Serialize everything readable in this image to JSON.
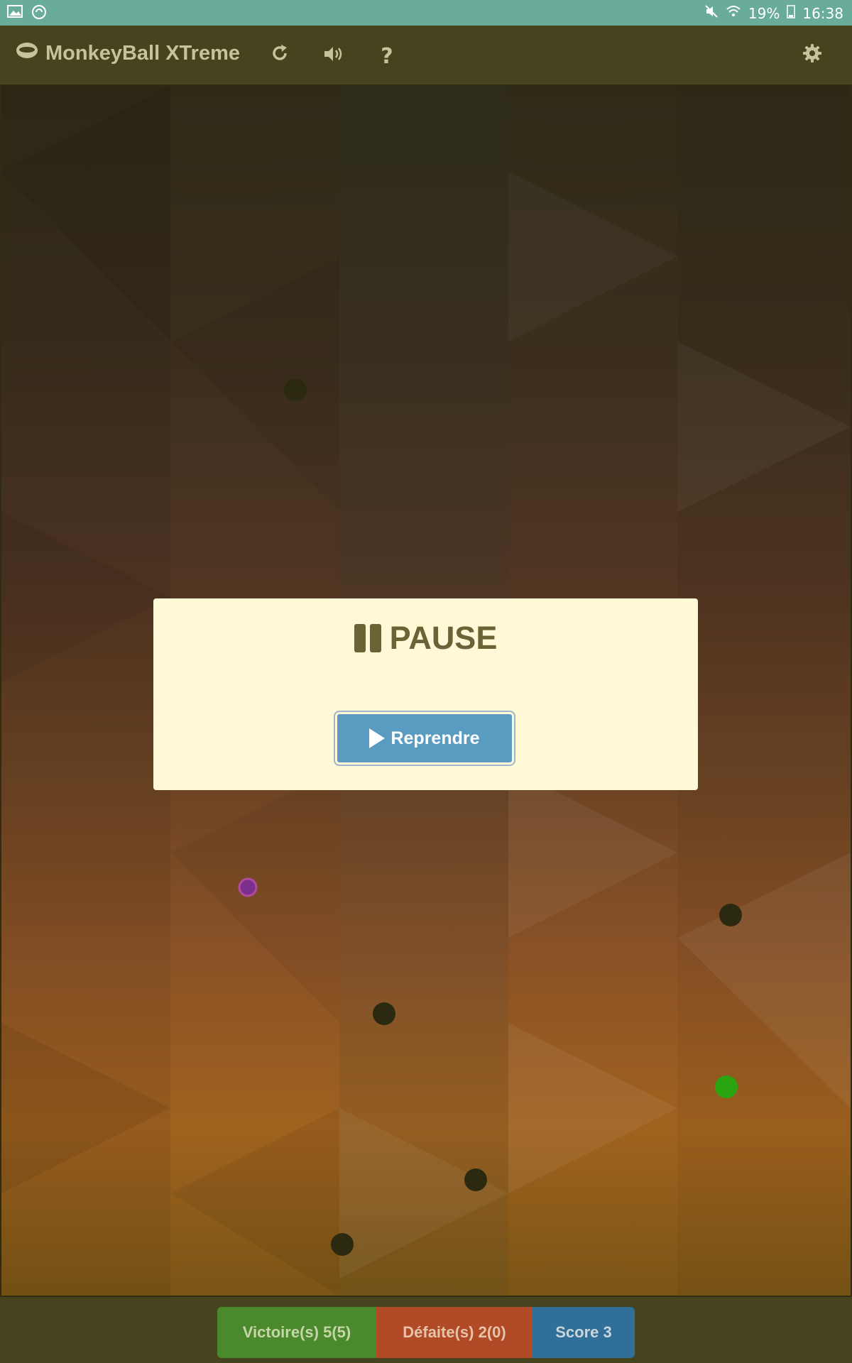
{
  "status_bar": {
    "left_icons": [
      "image-icon",
      "sync-icon"
    ],
    "mute_icon": "mute-icon",
    "wifi_icon": "wifi-icon",
    "battery": "19%",
    "time": "16:38"
  },
  "app": {
    "title": "MonkeyBall XTreme",
    "logo_icon": "ball-logo-icon",
    "restart_icon": "restart-icon",
    "sound_icon": "sound-icon",
    "help_label": "?",
    "settings_icon": "gear-icon"
  },
  "pause_dialog": {
    "title": "PAUSE",
    "resume_label": "Reprendre"
  },
  "game": {
    "balls": [
      {
        "type": "hole",
        "color": "#2b2a10"
      },
      {
        "type": "player",
        "color": "#7d2f8d"
      },
      {
        "type": "hole",
        "color": "#2b2a10"
      },
      {
        "type": "hole",
        "color": "#2b2a10"
      },
      {
        "type": "target",
        "color": "#2aa511"
      },
      {
        "type": "hole",
        "color": "#2b2a10"
      },
      {
        "type": "hole",
        "color": "#2b2a10"
      }
    ]
  },
  "scores": {
    "victories": "Victoire(s) 5(5)",
    "defeats": "Défaite(s) 2(0)",
    "score": "Score 3"
  },
  "colors": {
    "status_bar": "#6aac9c",
    "toolbar": "#45441f",
    "dialog": "#fff9d8",
    "resume_button": "#5a9bc2",
    "victory": "#4a8a2c",
    "defeat": "#b04a27",
    "score": "#2f6f98"
  }
}
